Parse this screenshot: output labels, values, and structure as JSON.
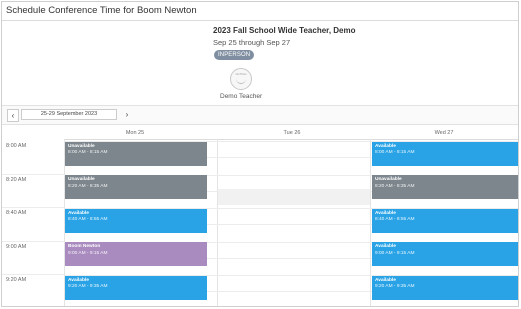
{
  "header": {
    "title": "Schedule Conference Time for Boom Newton"
  },
  "event": {
    "title": "2023 Fall School Wide  Teacher, Demo",
    "dates": "Sep 25 through Sep 27",
    "badge": "INPERSON",
    "avatar_text": "No Photo",
    "teacher_name": "Demo Teacher"
  },
  "nav": {
    "prev": "‹",
    "range": "25-29 September 2023",
    "next": "›"
  },
  "calendar": {
    "days": [
      "Mon 25",
      "Tue 26",
      "Wed 27"
    ],
    "times": [
      "8:00 AM",
      "8:20 AM",
      "8:40 AM",
      "9:00 AM",
      "9:20 AM"
    ],
    "slots": {
      "mon": [
        {
          "status": "unavailable",
          "title": "Unavailable",
          "time": "8:00 AM - 8:15 AM"
        },
        {
          "status": "unavailable",
          "title": "Unavailable",
          "time": "8:20 AM - 8:35 AM"
        },
        {
          "status": "available",
          "title": "Available",
          "time": "8:40 AM - 8:55 AM"
        },
        {
          "status": "booked",
          "title": "Boom Newton",
          "time": "9:00 AM - 9:15 AM"
        },
        {
          "status": "available",
          "title": "Available",
          "time": "9:20 AM - 9:35 AM"
        }
      ],
      "wed": [
        {
          "status": "available",
          "title": "Available",
          "time": "8:00 AM - 8:15 AM"
        },
        {
          "status": "unavailable",
          "title": "Unavailable",
          "time": "8:20 AM - 8:35 AM"
        },
        {
          "status": "available",
          "title": "Available",
          "time": "8:40 AM - 8:55 AM"
        },
        {
          "status": "available",
          "title": "Available",
          "time": "9:00 AM - 9:15 AM"
        },
        {
          "status": "available",
          "title": "Available",
          "time": "9:20 AM - 9:35 AM"
        }
      ]
    }
  },
  "colors": {
    "available": "#29a3e6",
    "unavailable": "#7c868c",
    "booked": "#a98bbf",
    "badge": "#7f8ea0"
  }
}
